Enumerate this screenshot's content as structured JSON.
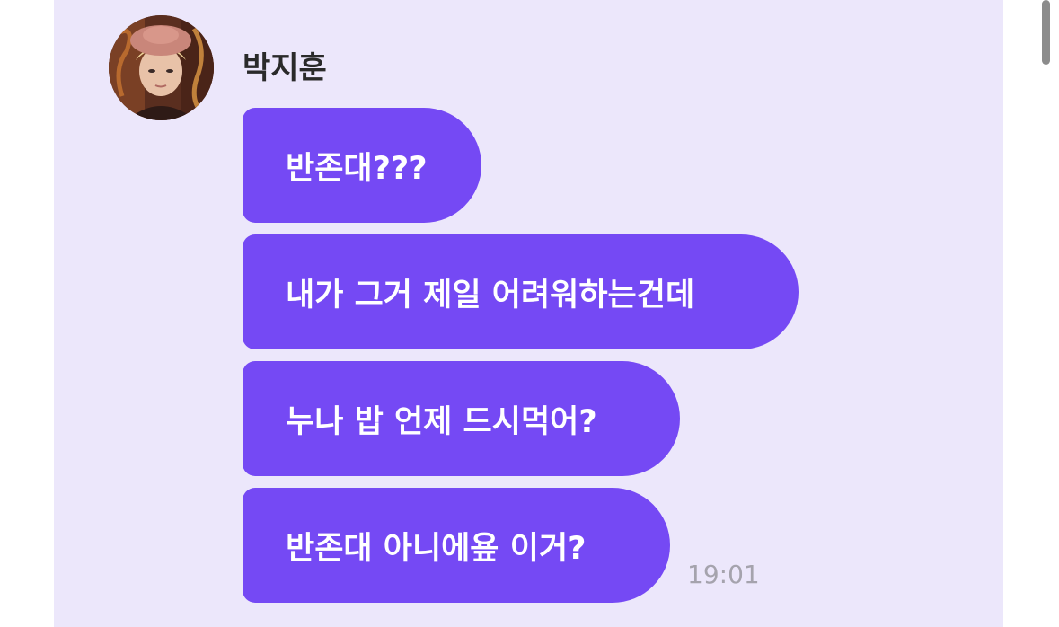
{
  "chat": {
    "sender_name": "박지훈",
    "messages": [
      {
        "text": "반존대???"
      },
      {
        "text": "내가 그거 제일 어려워하는건데"
      },
      {
        "text": "누나 밥 언제 드시먹어?"
      },
      {
        "text": "반존대 아니에욮 이거?"
      }
    ],
    "timestamp": "19:01"
  },
  "colors": {
    "panel_background": "#ece7fb",
    "bubble": "#7549f4",
    "bubble_text": "#ffffff",
    "name_text": "#2a2a2a",
    "timestamp_text": "#a5a3ad"
  },
  "icons": {
    "avatar": "profile-photo"
  }
}
